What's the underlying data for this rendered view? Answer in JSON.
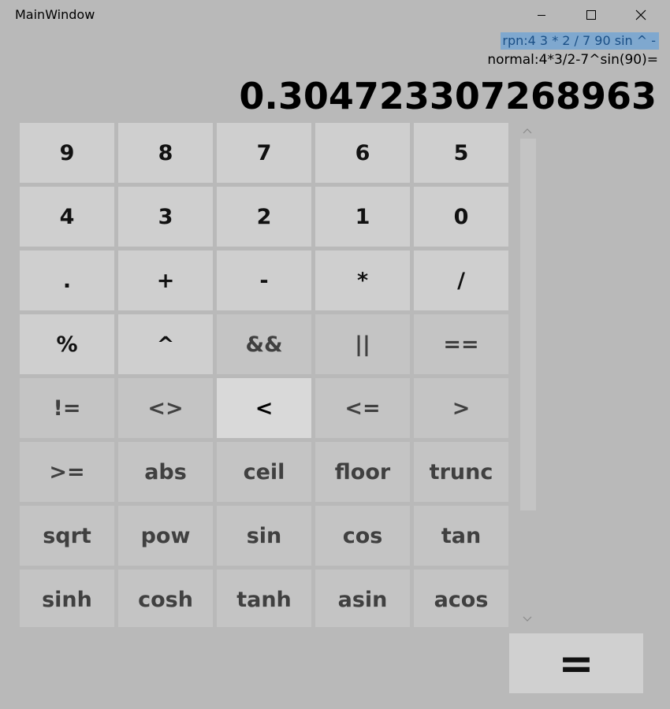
{
  "window": {
    "title": "MainWindow",
    "minimize_icon": "minimize-icon",
    "maximize_icon": "maximize-icon",
    "close_icon": "close-icon"
  },
  "display": {
    "rpn": "rpn:4 3 * 2 / 7 90 sin ^ -",
    "normal": "normal:4*3/2-7^sin(90)=",
    "result": "0.304723307268963"
  },
  "keys": [
    [
      "9",
      "8",
      "7",
      "6",
      "5"
    ],
    [
      "4",
      "3",
      "2",
      "1",
      "0"
    ],
    [
      ".",
      "+",
      "-",
      "*",
      "/"
    ],
    [
      "%",
      "^",
      "&&",
      "||",
      "=="
    ],
    [
      "!=",
      "<>",
      "<",
      "<=",
      ">"
    ],
    [
      ">=",
      "abs",
      "ceil",
      "floor",
      "trunc"
    ],
    [
      "sqrt",
      "pow",
      "sin",
      "cos",
      "tan"
    ],
    [
      "sinh",
      "cosh",
      "tanh",
      "asin",
      "acos"
    ]
  ],
  "equals_label": "=",
  "scrollbar": {
    "up_icon": "chevron-up-icon",
    "down_icon": "chevron-down-icon"
  }
}
